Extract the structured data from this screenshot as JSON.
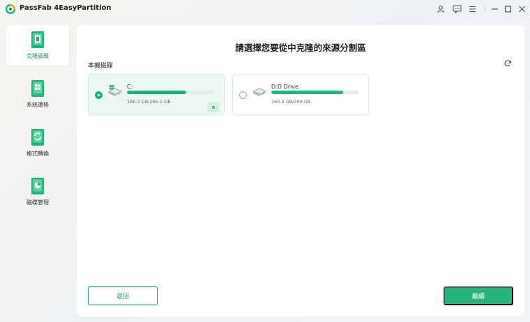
{
  "app": {
    "title": "PassFab 4EasyPartition"
  },
  "titlebar_icons": [
    "user-icon",
    "feedback-icon",
    "menu-icon",
    "minimize-icon",
    "maximize-icon",
    "close-icon"
  ],
  "sidebar": {
    "items": [
      {
        "label": "克隆磁碟",
        "icon": "clone-disk-icon",
        "active": true
      },
      {
        "label": "系統遷移",
        "icon": "system-migrate-icon",
        "active": false
      },
      {
        "label": "格式轉換",
        "icon": "format-convert-icon",
        "active": false
      },
      {
        "label": "磁碟管理",
        "icon": "disk-manage-icon",
        "active": false
      }
    ]
  },
  "main": {
    "title": "請選擇您要從中克隆的來源分割區",
    "section_label": "本機磁碟",
    "drives": [
      {
        "name": "C:",
        "size": "180.3 GB/265.1 GB",
        "used_fraction": 0.68,
        "selected": true,
        "system_badge": "⊞"
      },
      {
        "name": "D:D Drive",
        "size": "163.8 GB/200 GB",
        "used_fraction": 0.82,
        "selected": false
      }
    ],
    "back_label": "返回",
    "next_label": "繼續"
  },
  "colors": {
    "accent": "#25b57b",
    "accent_dark": "#1a8f5c",
    "selected_bg": "#eaf8f1"
  }
}
